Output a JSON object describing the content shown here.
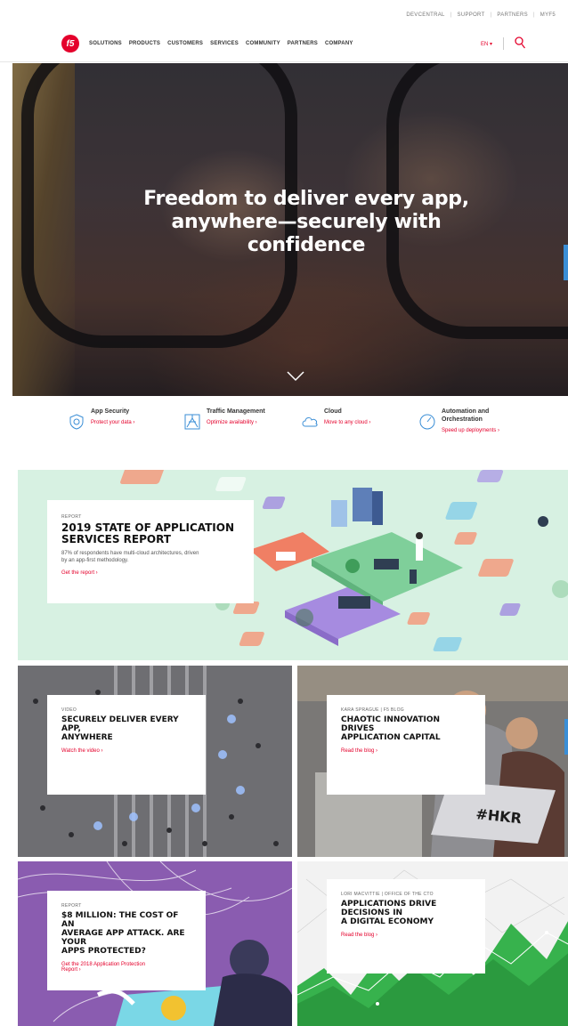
{
  "utility_nav": [
    "DEVCENTRAL",
    "SUPPORT",
    "PARTNERS",
    "MYF5"
  ],
  "logo": "f5",
  "main_nav": [
    "SOLUTIONS",
    "PRODUCTS",
    "CUSTOMERS",
    "SERVICES",
    "COMMUNITY",
    "PARTNERS",
    "COMPANY"
  ],
  "lang": "EN ▾",
  "hero": {
    "headline_1": "Freedom to deliver every app,",
    "headline_2": "anywhere—securely with",
    "headline_3": "confidence"
  },
  "solutions": [
    {
      "title": "App Security",
      "link": "Protect your data ›",
      "icon": "shield-icon"
    },
    {
      "title": "Traffic Management",
      "link": "Optimize availability ›",
      "icon": "traffic-icon"
    },
    {
      "title": "Cloud",
      "link": "Move to any cloud ›",
      "icon": "cloud-icon"
    },
    {
      "title": "Automation and",
      "title2": "Orchestration",
      "link": "Speed up deployments ›",
      "icon": "gauge-icon"
    }
  ],
  "report": {
    "kicker": "REPORT",
    "title_1": "2019 STATE OF APPLICATION",
    "title_2": "SERVICES REPORT",
    "body_1": "87% of respondents have multi-cloud architectures, driven",
    "body_2": "by an app-first methodology.",
    "link": "Get the report ›"
  },
  "tiles": [
    {
      "kicker": "VIDEO",
      "title_1": "SECURELY DELIVER EVERY APP,",
      "title_2": "ANYWHERE",
      "link": "Watch the video ›"
    },
    {
      "kicker": "KARA SPRAGUE | F5 BLOG",
      "title_1": "CHAOTIC INNOVATION DRIVES",
      "title_2": "APPLICATION CAPITAL",
      "link": "Read the blog ›"
    },
    {
      "kicker": "REPORT",
      "title_1": "$8 MILLION: THE COST OF AN",
      "title_2": "AVERAGE APP ATTACK. ARE YOUR",
      "title_3": "APPS PROTECTED?",
      "link_1": "Get the 2018 Application Protection",
      "link_2": "Report ›"
    },
    {
      "kicker": "LORI MACVITTIE | OFFICE OF THE CTO",
      "title_1": "APPLICATIONS DRIVE DECISIONS IN",
      "title_2": "A DIGITAL ECONOMY",
      "link": "Read the blog ›"
    }
  ],
  "laptop_sticker": "#HKR"
}
